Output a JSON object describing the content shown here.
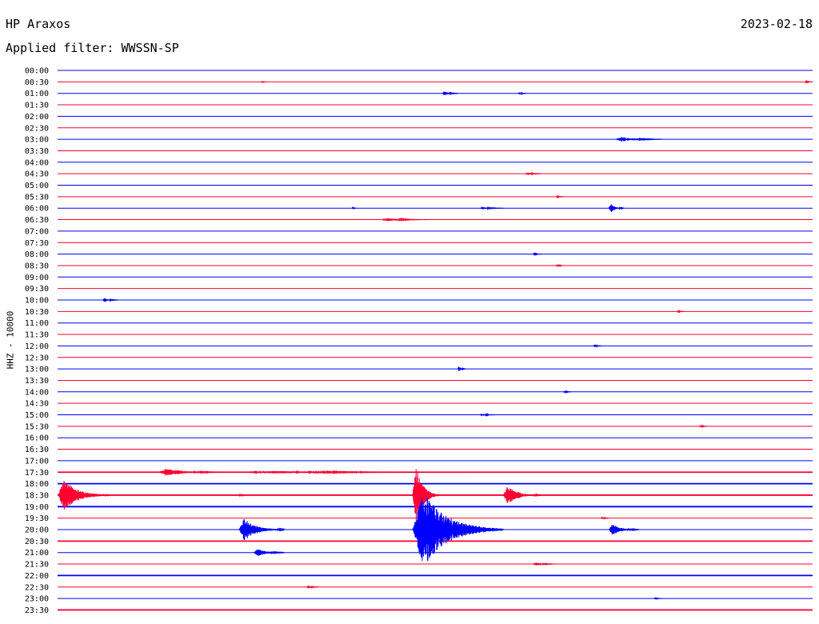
{
  "header": {
    "station": "HP Araxos",
    "date": "2023-02-18",
    "filter_label": "Applied filter: WWSSN-SP"
  },
  "channel_label": "HHZ - 10000",
  "colors": {
    "blue": "#0000ff",
    "red": "#ff0033"
  },
  "chart_data": {
    "type": "line",
    "rows": [
      "00:00",
      "00:30",
      "01:00",
      "01:30",
      "02:00",
      "02:30",
      "03:00",
      "03:30",
      "04:00",
      "04:30",
      "05:00",
      "05:30",
      "06:00",
      "06:30",
      "07:00",
      "07:30",
      "08:00",
      "08:30",
      "09:00",
      "09:30",
      "10:00",
      "10:30",
      "11:00",
      "11:30",
      "12:00",
      "12:30",
      "13:00",
      "13:30",
      "14:00",
      "14:30",
      "15:00",
      "15:30",
      "16:00",
      "16:30",
      "17:00",
      "17:30",
      "18:00",
      "18:30",
      "19:00",
      "19:30",
      "20:00",
      "20:30",
      "21:00",
      "21:30",
      "22:00",
      "22:30",
      "23:00",
      "23:30"
    ],
    "events": [
      {
        "row": 1,
        "start": 0.99,
        "dur": 0.01,
        "amp": 1
      },
      {
        "row": 1,
        "start": 0.27,
        "dur": 0.005,
        "amp": 1
      },
      {
        "row": 2,
        "start": 0.51,
        "dur": 0.02,
        "amp": 3
      },
      {
        "row": 2,
        "start": 0.61,
        "dur": 0.01,
        "amp": 2
      },
      {
        "row": 6,
        "start": 0.74,
        "dur": 0.06,
        "amp": 3
      },
      {
        "row": 9,
        "start": 0.62,
        "dur": 0.02,
        "amp": 2
      },
      {
        "row": 11,
        "start": 0.66,
        "dur": 0.01,
        "amp": 1
      },
      {
        "row": 12,
        "start": 0.73,
        "dur": 0.02,
        "amp": 6
      },
      {
        "row": 12,
        "start": 0.56,
        "dur": 0.03,
        "amp": 1.5
      },
      {
        "row": 12,
        "start": 0.39,
        "dur": 0.005,
        "amp": 1.5
      },
      {
        "row": 13,
        "start": 0.43,
        "dur": 0.06,
        "amp": 2
      },
      {
        "row": 16,
        "start": 0.63,
        "dur": 0.01,
        "amp": 1
      },
      {
        "row": 17,
        "start": 0.66,
        "dur": 0.01,
        "amp": 2
      },
      {
        "row": 20,
        "start": 0.06,
        "dur": 0.02,
        "amp": 3
      },
      {
        "row": 21,
        "start": 0.82,
        "dur": 0.01,
        "amp": 1
      },
      {
        "row": 24,
        "start": 0.71,
        "dur": 0.01,
        "amp": 1.5
      },
      {
        "row": 26,
        "start": 0.53,
        "dur": 0.01,
        "amp": 4
      },
      {
        "row": 28,
        "start": 0.67,
        "dur": 0.01,
        "amp": 1.5
      },
      {
        "row": 30,
        "start": 0.56,
        "dur": 0.02,
        "amp": 1.5
      },
      {
        "row": 31,
        "start": 0.85,
        "dur": 0.01,
        "amp": 1.5
      },
      {
        "row": 35,
        "start": 0.135,
        "dur": 0.08,
        "amp": 5
      },
      {
        "row": 35,
        "start": 0.25,
        "dur": 0.3,
        "amp": 1.5
      },
      {
        "row": 37,
        "start": 0.0,
        "dur": 0.07,
        "amp": 20
      },
      {
        "row": 37,
        "start": 0.24,
        "dur": 0.01,
        "amp": 2
      },
      {
        "row": 37,
        "start": 0.59,
        "dur": 0.05,
        "amp": 12
      },
      {
        "row": 37,
        "start": 0.47,
        "dur": 0.035,
        "amp": 42
      },
      {
        "row": 39,
        "start": 0.72,
        "dur": 0.01,
        "amp": 2
      },
      {
        "row": 40,
        "start": 0.24,
        "dur": 0.06,
        "amp": 14
      },
      {
        "row": 40,
        "start": 0.47,
        "dur": 0.12,
        "amp": 48
      },
      {
        "row": 40,
        "start": 0.73,
        "dur": 0.04,
        "amp": 7
      },
      {
        "row": 42,
        "start": 0.26,
        "dur": 0.04,
        "amp": 5
      },
      {
        "row": 43,
        "start": 0.63,
        "dur": 0.03,
        "amp": 2
      },
      {
        "row": 45,
        "start": 0.33,
        "dur": 0.015,
        "amp": 2
      },
      {
        "row": 46,
        "start": 0.79,
        "dur": 0.01,
        "amp": 1
      }
    ],
    "noisy_rows": [
      35,
      36,
      37,
      38,
      41,
      44,
      47
    ]
  }
}
